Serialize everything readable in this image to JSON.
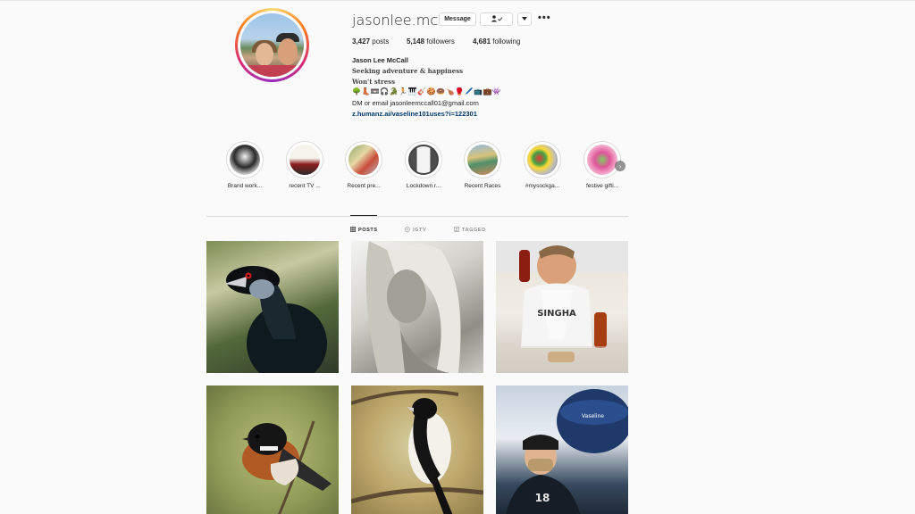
{
  "profile": {
    "username": "jasonlee.mccall",
    "message_label": "Message",
    "following_icon": "person-check-icon",
    "dropdown_icon": "chevron-down-icon",
    "more_label": "•••",
    "stats": {
      "posts": "3,427",
      "posts_label": "posts",
      "followers": "5,148",
      "followers_label": "followers",
      "following": "4,681",
      "following_label": "following"
    },
    "bio": {
      "name": "Jason Lee McCall",
      "line1": "Seeking adventure & happiness",
      "line2": "Won't stress",
      "emoji_line": "🌳👢📼🎧🐊🏃🎹🎸🍪🍩🍗🥊🖊️📺💼👾",
      "dm": "DM or email jasonleemccall01@gmail.com",
      "link": "z.humanz.ai/vaseline101uses?i=122301"
    }
  },
  "highlights": [
    {
      "label": "Brand work..."
    },
    {
      "label": "recent TV ..."
    },
    {
      "label": "Recent pre..."
    },
    {
      "label": "Lockdown r..."
    },
    {
      "label": "Recent Races"
    },
    {
      "label": "#mysockga..."
    },
    {
      "label": "festive gifti..."
    }
  ],
  "tabs": {
    "posts": "POSTS",
    "igtv": "IGTV",
    "tagged": "TAGGED"
  },
  "post_subjects": [
    "crested-bird",
    "woman-portrait",
    "man-with-hot-sauce",
    "stonechat-bird",
    "magpie-bird",
    "vaseline-product-photo"
  ]
}
